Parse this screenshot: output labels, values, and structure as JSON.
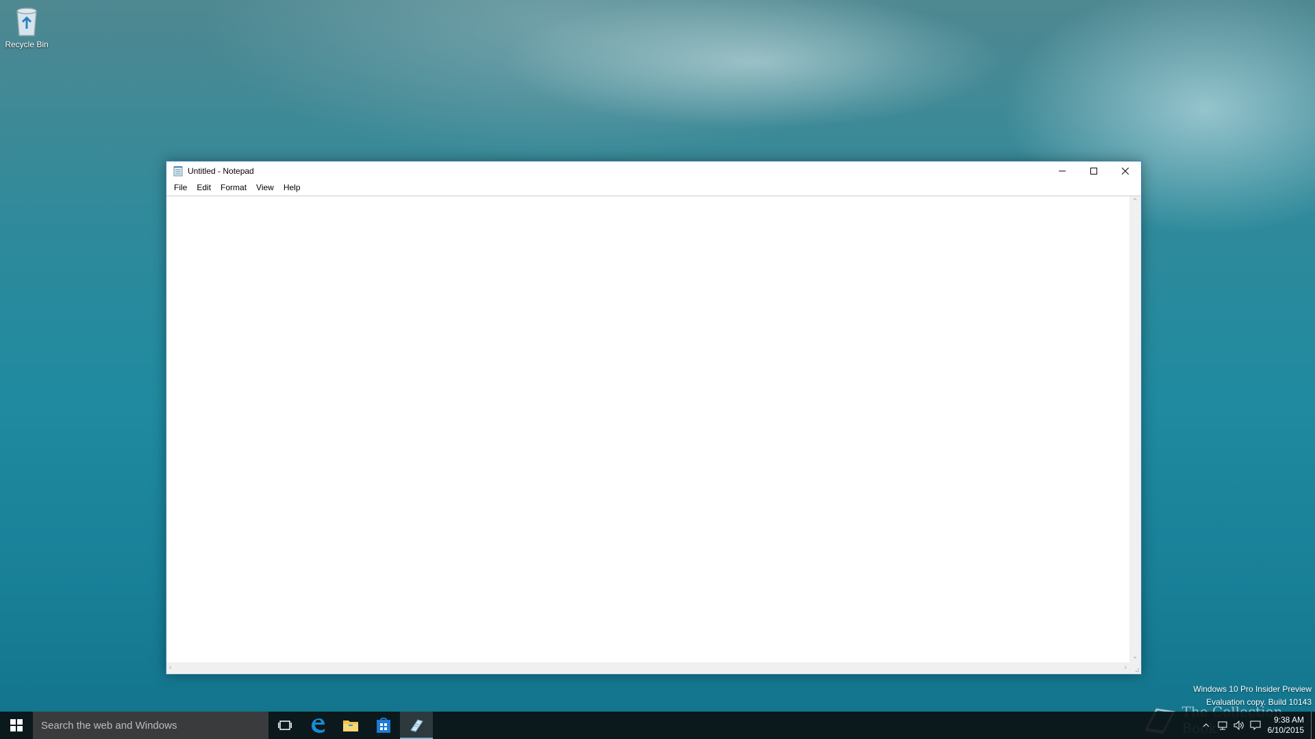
{
  "desktop": {
    "icons": [
      {
        "label": "Recycle Bin"
      }
    ]
  },
  "notepad": {
    "title": "Untitled - Notepad",
    "menu": [
      "File",
      "Edit",
      "Format",
      "View",
      "Help"
    ],
    "content": ""
  },
  "watermark": {
    "line1": "Windows 10 Pro Insider Preview",
    "line2": "Evaluation copy. Build 10143"
  },
  "brand": {
    "text": "The Collection Book"
  },
  "taskbar": {
    "search_placeholder": "Search the web and Windows",
    "pinned": [
      "task-view-icon",
      "edge-icon",
      "file-explorer-icon",
      "store-icon",
      "notepad-icon"
    ],
    "active": "notepad-icon",
    "accent_color": "#74b9e6"
  },
  "clock": {
    "time": "9:38 AM",
    "date": "6/10/2015"
  }
}
